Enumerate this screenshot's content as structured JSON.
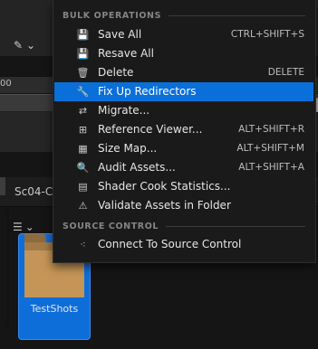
{
  "background": {
    "ruler_label": "00",
    "tab_label": "Sc04-C",
    "asset_name": "TestShots"
  },
  "menu": {
    "sections": [
      {
        "title": "BULK OPERATIONS",
        "items": [
          {
            "label": "Save All",
            "shortcut": "CTRL+SHIFT+S",
            "icon": "save-icon",
            "highlighted": false
          },
          {
            "label": "Resave All",
            "shortcut": "",
            "icon": "save-icon",
            "highlighted": false
          },
          {
            "label": "Delete",
            "shortcut": "DELETE",
            "icon": "trash-icon",
            "highlighted": false
          },
          {
            "label": "Fix Up Redirectors",
            "shortcut": "",
            "icon": "wrench-icon",
            "highlighted": true
          },
          {
            "label": "Migrate...",
            "shortcut": "",
            "icon": "migrate-icon",
            "highlighted": false
          },
          {
            "label": "Reference Viewer...",
            "shortcut": "ALT+SHIFT+R",
            "icon": "reference-viewer-icon",
            "highlighted": false
          },
          {
            "label": "Size Map...",
            "shortcut": "ALT+SHIFT+M",
            "icon": "size-map-icon",
            "highlighted": false
          },
          {
            "label": "Audit Assets...",
            "shortcut": "ALT+SHIFT+A",
            "icon": "audit-icon",
            "highlighted": false
          },
          {
            "label": "Shader Cook Statistics...",
            "shortcut": "",
            "icon": "stats-icon",
            "highlighted": false
          },
          {
            "label": "Validate Assets in Folder",
            "shortcut": "",
            "icon": "validate-icon",
            "highlighted": false
          }
        ]
      },
      {
        "title": "SOURCE CONTROL",
        "items": [
          {
            "label": "Connect To Source Control",
            "shortcut": "",
            "icon": "source-control-icon",
            "highlighted": false
          }
        ]
      }
    ]
  }
}
